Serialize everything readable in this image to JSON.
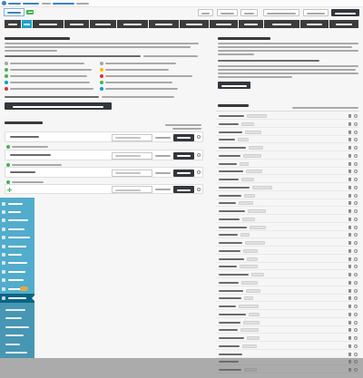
{
  "theme": {
    "page_background": "#f6f6f6",
    "admin_menu_background": "#52accc",
    "admin_menu_current": "#096484",
    "admin_submenu_background": "#4796b3",
    "notification_badge": "#e1a948",
    "nav_tab_background": "#3c3c3c",
    "nav_tab_active": "#1fa2c9",
    "dark_button": "#32373c",
    "logo_badge": "#46b450",
    "link": "#3f84bf",
    "group_meta_icon": "#46b450"
  },
  "nav": {
    "active_tab": 2
  },
  "status_list": [
    {
      "icon": "info-circle-icon",
      "color": "#a0a5aa"
    },
    {
      "icon": "info-circle-icon",
      "color": "#a0a5aa"
    },
    {
      "icon": "check-circle-icon",
      "color": "#46b450"
    },
    {
      "icon": "warning-icon",
      "color": "#ffb900"
    },
    {
      "icon": "check-circle-icon",
      "color": "#46b450"
    },
    {
      "icon": "error-icon",
      "color": "#dc3232"
    },
    {
      "icon": "info-icon",
      "color": "#00a0d2"
    },
    {
      "icon": "check-circle-icon",
      "color": "#46b450"
    },
    {
      "icon": "error-icon",
      "color": "#dc3232"
    },
    {
      "icon": "info-icon",
      "color": "#00a0d2"
    }
  ],
  "row_action_icons": [
    "trash-icon",
    "gear-icon"
  ]
}
